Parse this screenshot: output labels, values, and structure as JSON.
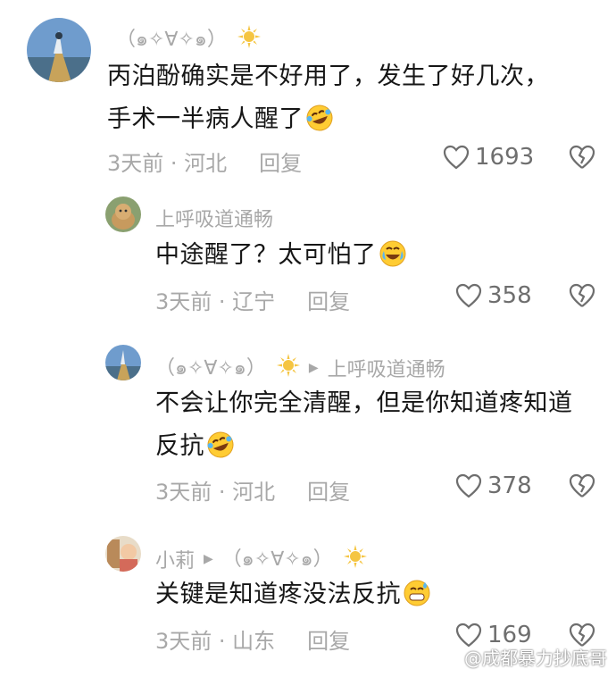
{
  "comments": [
    {
      "user": "（๑✧∀✧๑）",
      "text_line1": "丙泊酚确实是不好用了，发生了好几次，",
      "text_line2": "手术一半病人醒了",
      "time": "3天前 · 河北",
      "reply": "回复",
      "likes": "1693"
    },
    {
      "user": "上呼吸道通畅",
      "text_line1": "中途醒了？太可怕了",
      "time": "3天前 · 辽宁",
      "reply": "回复",
      "likes": "358"
    },
    {
      "user": "（๑✧∀✧๑）",
      "reply_to": "上呼吸道通畅",
      "text_line1": "不会让你完全清醒，但是你知道疼知道",
      "text_line2": "反抗",
      "time": "3天前 · 河北",
      "reply": "回复",
      "likes": "378"
    },
    {
      "user": "小莉",
      "reply_to": "（๑✧∀✧๑）",
      "text_line1": "关键是知道疼没法反抗",
      "time": "3天前 · 山东",
      "reply": "回复",
      "likes": "169"
    }
  ],
  "watermark": "@成都暴力抄底哥",
  "colors": {
    "meta": "#a8a8a8",
    "text": "#161616",
    "sun": "#f5c542"
  }
}
